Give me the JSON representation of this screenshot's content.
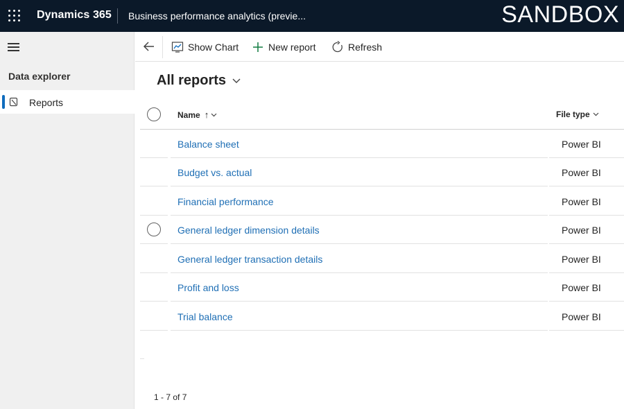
{
  "topbar": {
    "waffle_icon": "waffle-icon",
    "brand": "Dynamics 365",
    "app_title": "Business performance analytics (previe...",
    "environment": "SANDBOX",
    "background": "#0b1929"
  },
  "leftnav": {
    "menu_icon": "hamburger-icon",
    "section_title": "Data explorer",
    "items": [
      {
        "label": "Reports",
        "icon": "report-icon",
        "selected": true
      }
    ],
    "selection_color": "#0f6cbd"
  },
  "commandbar": {
    "back_icon": "back-arrow-icon",
    "buttons": [
      {
        "label": "Show Chart",
        "icon": "chart-icon"
      },
      {
        "label": "New report",
        "icon": "plus-icon"
      },
      {
        "label": "Refresh",
        "icon": "refresh-icon"
      }
    ]
  },
  "view": {
    "title": "All reports",
    "chevron_icon": "chevron-down-icon"
  },
  "grid": {
    "columns": [
      {
        "label": "Name",
        "sort": "ascending"
      },
      {
        "label": "File type"
      }
    ],
    "rows": [
      {
        "name": "Balance sheet",
        "file_type": "Power BI"
      },
      {
        "name": "Budget vs. actual",
        "file_type": "Power BI"
      },
      {
        "name": "Financial performance",
        "file_type": "Power BI"
      },
      {
        "name": "General ledger dimension details",
        "file_type": "Power BI"
      },
      {
        "name": "General ledger transaction details",
        "file_type": "Power BI"
      },
      {
        "name": "Profit and loss",
        "file_type": "Power BI"
      },
      {
        "name": "Trial balance",
        "file_type": "Power BI"
      }
    ],
    "link_color": "#1f6fb5"
  },
  "pager": {
    "text": "1 - 7 of 7"
  }
}
